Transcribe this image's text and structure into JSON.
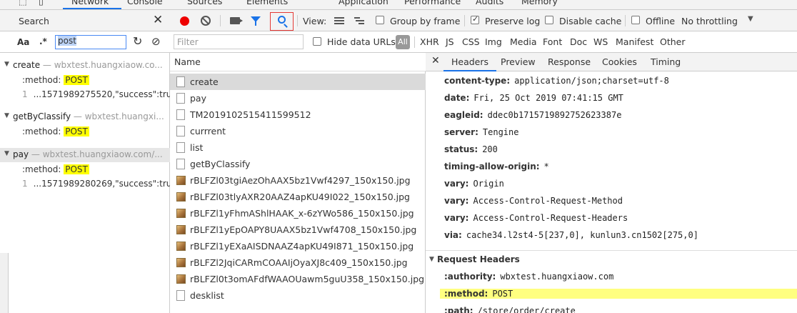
{
  "top_tabs": [
    "Network",
    "Console",
    "Sources",
    "Elements",
    "Application",
    "Performance",
    "Audits",
    "Memory"
  ],
  "search_panel": {
    "title": "Search",
    "case_label": "Aa",
    "regex_label": ".*",
    "query": "post",
    "results": [
      {
        "name": "create",
        "url": "— wbxtest.huangxiaow.co...",
        "lines": [
          {
            "text": ":method: ",
            "hl": "POST",
            "num": ""
          },
          {
            "num": "1",
            "text": "...1571989275520,\"success\":tru...",
            "hl": ""
          }
        ]
      },
      {
        "name": "getByClassify",
        "url": "— wbxtest.huangxi...",
        "lines": [
          {
            "text": ":method: ",
            "hl": "POST",
            "num": ""
          }
        ]
      },
      {
        "name": "pay",
        "url": "— wbxtest.huangxiaow.com/...",
        "lines": [
          {
            "text": ":method: ",
            "hl": "POST",
            "num": ""
          },
          {
            "num": "1",
            "text": "...1571989280269,\"success\":tru...",
            "hl": ""
          }
        ]
      }
    ]
  },
  "toolbar": {
    "view_label": "View:",
    "group_by_frame": "Group by frame",
    "preserve_log": "Preserve log",
    "disable_cache": "Disable cache",
    "offline": "Offline",
    "throttling": "No throttling"
  },
  "filter": {
    "placeholder": "Filter",
    "hide_data_urls": "Hide data URLs",
    "all": "All",
    "types": [
      "XHR",
      "JS",
      "CSS",
      "Img",
      "Media",
      "Font",
      "Doc",
      "WS",
      "Manifest",
      "Other"
    ]
  },
  "requests": {
    "header": "Name",
    "rows": [
      {
        "name": "create",
        "kind": "doc",
        "selected": true
      },
      {
        "name": "pay",
        "kind": "doc",
        "selected": false
      },
      {
        "name": "TM2019102515411599512",
        "kind": "doc",
        "selected": false
      },
      {
        "name": "currrent",
        "kind": "doc",
        "selected": false
      },
      {
        "name": "list",
        "kind": "doc",
        "selected": false
      },
      {
        "name": "getByClassify",
        "kind": "doc",
        "selected": false
      },
      {
        "name": "rBLFZl03tgiAezOhAAX5bz1Vwf4297_150x150.jpg",
        "kind": "img",
        "selected": false
      },
      {
        "name": "rBLFZl03tlyAXR20AAZ4apKU49I022_150x150.jpg",
        "kind": "img",
        "selected": false
      },
      {
        "name": "rBLFZl1yFhmAShlHAAK_x-6zYWo586_150x150.jpg",
        "kind": "img",
        "selected": false
      },
      {
        "name": "rBLFZl1yEpOAPY8UAAX5bz1Vwf4708_150x150.jpg",
        "kind": "img",
        "selected": false
      },
      {
        "name": "rBLFZl1yEXaAISDNAAZ4apKU49I871_150x150.jpg",
        "kind": "img",
        "selected": false
      },
      {
        "name": "rBLFZl2JqiCARmCOAAIjOyaXJ8c409_150x150.jpg",
        "kind": "img",
        "selected": false
      },
      {
        "name": "rBLFZl0t3omAFdfWAAOUawm5guU358_150x150.jpg",
        "kind": "img",
        "selected": false
      },
      {
        "name": "desklist",
        "kind": "doc",
        "selected": false
      }
    ]
  },
  "detail": {
    "tabs": [
      "Headers",
      "Preview",
      "Response",
      "Cookies",
      "Timing"
    ],
    "response_headers": [
      {
        "k": "content-type:",
        "v": "application/json;charset=utf-8"
      },
      {
        "k": "date:",
        "v": "Fri, 25 Oct 2019 07:41:15 GMT"
      },
      {
        "k": "eagleid:",
        "v": "ddec0b1715719892752623387e"
      },
      {
        "k": "server:",
        "v": "Tengine"
      },
      {
        "k": "status:",
        "v": "200"
      },
      {
        "k": "timing-allow-origin:",
        "v": "*"
      },
      {
        "k": "vary:",
        "v": "Origin"
      },
      {
        "k": "vary:",
        "v": "Access-Control-Request-Method"
      },
      {
        "k": "vary:",
        "v": "Access-Control-Request-Headers"
      },
      {
        "k": "via:",
        "v": "cache34.l2st4-5[237,0], kunlun3.cn1502[275,0]"
      }
    ],
    "request_section": "Request Headers",
    "request_headers": [
      {
        "k": ":authority:",
        "v": "wbxtest.huangxiaow.com",
        "hl": false
      },
      {
        "k": ":method:",
        "v": "POST",
        "hl": true
      },
      {
        "k": ":path:",
        "v": "/store/order/create",
        "hl": false
      }
    ]
  }
}
